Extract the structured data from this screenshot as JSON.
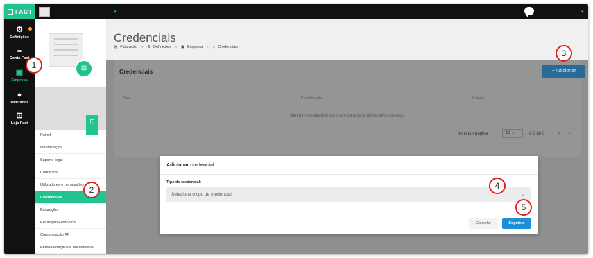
{
  "app": {
    "logo_text": "FACT"
  },
  "rail": [
    {
      "label": "Definições"
    },
    {
      "label": "Conta Fact"
    },
    {
      "label": "Empresa"
    },
    {
      "label": "Utilizador"
    },
    {
      "label": "Loja Fact"
    }
  ],
  "menu": [
    {
      "label": "Painel"
    },
    {
      "label": "Identificação"
    },
    {
      "label": "Suporte legal"
    },
    {
      "label": "Contactos"
    },
    {
      "label": "Utilizadores e permissões"
    },
    {
      "label": "Credenciais"
    },
    {
      "label": "Faturação"
    },
    {
      "label": "Faturação Eletrónica"
    },
    {
      "label": "Comunicação AT"
    },
    {
      "label": "Personalização de documentos"
    }
  ],
  "page": {
    "title": "Credenciais",
    "breadcrumb": [
      "Faturação",
      "Definições",
      "Empresa",
      "Credenciais"
    ]
  },
  "card": {
    "title": "Credenciais",
    "add_button": "+ Adicionar",
    "columns": [
      "Tipo",
      "Predefinição",
      "Estado"
    ],
    "empty": "Nenhum resultado encontrado para os critérios seleccionados",
    "items_per_page_label": "Itens por página:",
    "items_per_page": "10",
    "range": "0-0 de 0"
  },
  "dialog": {
    "title": "Adicionar credencial",
    "field_label": "Tipo de credencial:",
    "select_placeholder": "Selecione o tipo de credencial",
    "cancel": "Cancelar",
    "next": "Seguinte"
  },
  "callouts": [
    "1",
    "2",
    "3",
    "4",
    "5"
  ],
  "colors": {
    "accent": "#22c391",
    "primary": "#1c8fd6",
    "callout": "#e02020"
  }
}
